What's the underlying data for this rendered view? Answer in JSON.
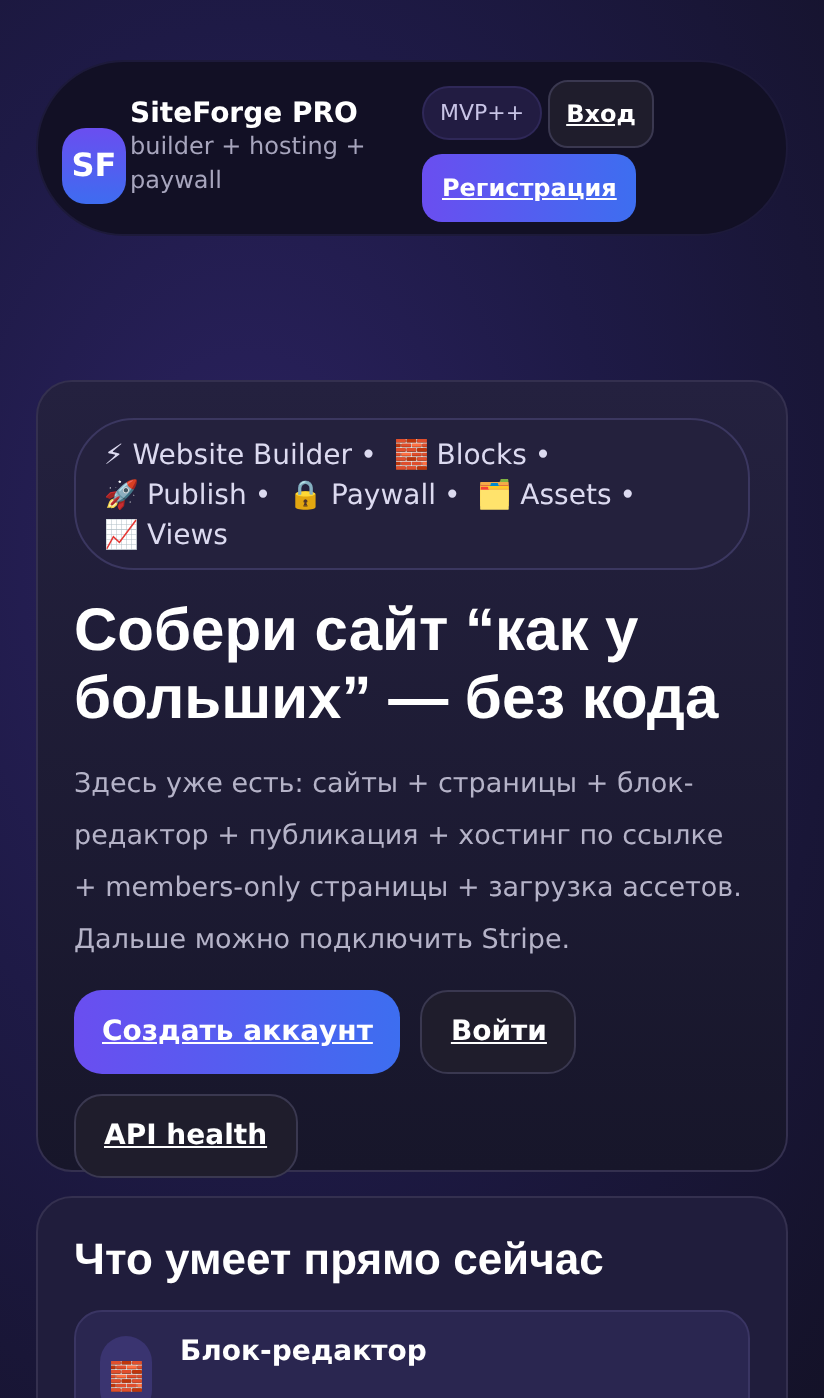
{
  "header": {
    "logo": "SF",
    "brand": "SiteForge PRO",
    "tagline": "builder + hosting + paywall",
    "badge": "MVP++",
    "login": "Вход",
    "register": "Регистрация"
  },
  "hero": {
    "features": [
      {
        "emoji": "⚡",
        "label": "Website Builder"
      },
      {
        "emoji": "🧱",
        "label": "Blocks"
      },
      {
        "emoji": "🚀",
        "label": "Publish"
      },
      {
        "emoji": "🔒",
        "label": "Paywall"
      },
      {
        "emoji": "🗂️",
        "label": "Assets"
      },
      {
        "emoji": "📈",
        "label": "Views"
      }
    ],
    "separator": "•",
    "title": "Собери сайт “как у больших” — без кода",
    "description": "Здесь уже есть: сайты + страницы + блок-редактор + публикация + хостинг по ссылке + members-only страницы + загрузка ассетов. Дальше можно подключить Stripe.",
    "buttons": [
      {
        "label": "Создать аккаунт",
        "kind": "primary"
      },
      {
        "label": "Войти",
        "kind": "secondary"
      },
      {
        "label": "API health",
        "kind": "secondary"
      }
    ]
  },
  "capabilities": {
    "title": "Что умеет прямо сейчас",
    "items": [
      {
        "emoji": "🧱",
        "title": "Блок-редактор"
      }
    ]
  }
}
